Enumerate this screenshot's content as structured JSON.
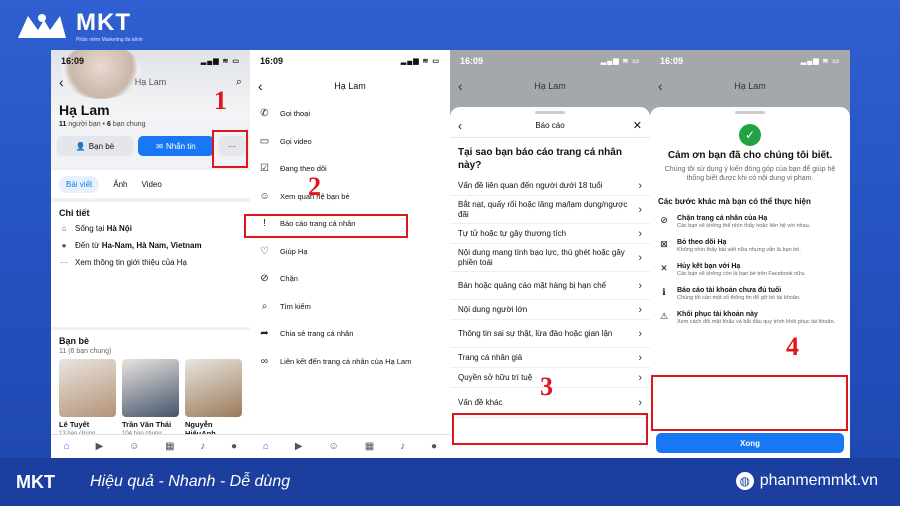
{
  "brand": {
    "name": "MKT",
    "tagline": "Phần mềm Marketing đa kênh",
    "slogan": "Hiệu quả - Nhanh  - Dễ dùng",
    "website": "phanmemmkt.vn"
  },
  "common": {
    "time": "16:09",
    "signal": "▂▄▆ ≋ ▭",
    "profile_name": "Hạ Lam"
  },
  "s1": {
    "name": "Hạ Lam",
    "friends_count": "11",
    "friends_word": "người bạn",
    "mutual_count": "6",
    "mutual_word": "bạn chung",
    "btn_friends": "Bạn bè",
    "btn_message": "Nhắn tin",
    "btn_more": "···",
    "tabs": [
      "Bài viết",
      "Ảnh",
      "Video"
    ],
    "details_title": "Chi tiết",
    "details": [
      {
        "icon": "home-icon",
        "glyph": "⌂",
        "text": "Sống tại ",
        "bold": "Hà Nội"
      },
      {
        "icon": "location-icon",
        "glyph": "●",
        "text": "Đến từ ",
        "bold": "Ha-Nam, Hà Nam, Vietnam"
      },
      {
        "icon": "more-icon",
        "glyph": "···",
        "text": "Xem thông tin giới thiệu của Hạ",
        "bold": ""
      }
    ],
    "friends_title": "Bạn bè",
    "friends_sub": "11 (6 bạn chung)",
    "friends": [
      {
        "name": "Lê Tuyết",
        "count": "13 bạn chung",
        "color": "#b49277"
      },
      {
        "name": "Trần Văn Thái",
        "count": "104 bạn chung",
        "color": "#45536b"
      },
      {
        "name": "Nguyễn HiếuAnh",
        "count": "",
        "color": "#9a7b5a"
      }
    ]
  },
  "s2": {
    "items": [
      {
        "icon": "phone-icon",
        "glyph": "✆",
        "label": "Gọi thoại"
      },
      {
        "icon": "video-icon",
        "glyph": "▭",
        "label": "Gọi video"
      },
      {
        "icon": "follow-icon",
        "glyph": "☑",
        "label": "Đang theo dõi"
      },
      {
        "icon": "friends-icon",
        "glyph": "☺",
        "label": "Xem quan hệ bạn bè"
      },
      {
        "icon": "report-icon",
        "glyph": "!",
        "label": "Báo cáo trang cá nhân"
      },
      {
        "icon": "help-icon",
        "glyph": "♡",
        "label": "Giúp Hạ"
      },
      {
        "icon": "block-icon",
        "glyph": "⊘",
        "label": "Chặn"
      },
      {
        "icon": "search-icon",
        "glyph": "⌕",
        "label": "Tìm kiếm"
      },
      {
        "icon": "share-icon",
        "glyph": "➦",
        "label": "Chia sẻ trang cá nhân"
      },
      {
        "icon": "link-icon",
        "glyph": "∞",
        "label": "Liên kết đến trang cá nhân của Hạ Lam"
      }
    ]
  },
  "s3": {
    "title": "Báo cáo",
    "question": "Tại sao bạn báo cáo trang cá nhân này?",
    "reasons": [
      "Vấn đề liên quan đến người dưới 18 tuổi",
      "Bắt nạt, quấy rối hoặc lăng mạ/lạm dụng/ngược đãi",
      "Tự tử hoặc tự gây thương tích",
      "Nội dung mang tính bạo lực, thù ghét hoặc gây phiền toái",
      "Bán hoặc quảng cáo mặt hàng bị hạn chế",
      "Nội dung người lớn",
      "Thông tin sai sự thật, lừa đảo hoặc gian lận",
      "Trang cá nhân giả",
      "Quyền sở hữu trí tuệ",
      "Vấn đề khác"
    ]
  },
  "s4": {
    "thanks": "Cảm ơn bạn đã cho chúng tôi biết.",
    "thanks_sub": "Chúng tôi sử dụng ý kiến đóng góp của bạn để giúp hệ thống biết được khi có nội dung vi phạm.",
    "steps_title": "Các bước khác mà bạn có thể thực hiện",
    "steps": [
      {
        "icon": "block-user-icon",
        "glyph": "⊘",
        "title": "Chặn trang cá nhân của Hạ",
        "desc": "Các bạn sẽ không thể nhìn thấy hoặc liên hệ với nhau."
      },
      {
        "icon": "unfollow-icon",
        "glyph": "⊠",
        "title": "Bỏ theo dõi Hạ",
        "desc": "Không nhìn thấy bài viết nữa nhưng vẫn là bạn bè."
      },
      {
        "icon": "unfriend-icon",
        "glyph": "✕",
        "title": "Hủy kết bạn với Hạ",
        "desc": "Các bạn sẽ không còn là bạn bè trên Facebook nữa."
      },
      {
        "icon": "info-icon",
        "glyph": "ℹ",
        "title": "Báo cáo tài khoản chưa đủ tuổi",
        "desc": "Chúng tôi cần một số thông tin để gỡ bỏ tài khoản."
      },
      {
        "icon": "warning-icon",
        "glyph": "⚠",
        "title": "Khôi phục tài khoản này",
        "desc": "Xem cách đổi mật khẩu và bắt đầu quy trình khôi phục tài khoản."
      }
    ],
    "done": "Xong"
  },
  "annotations": [
    "1",
    "2",
    "3",
    "4"
  ]
}
